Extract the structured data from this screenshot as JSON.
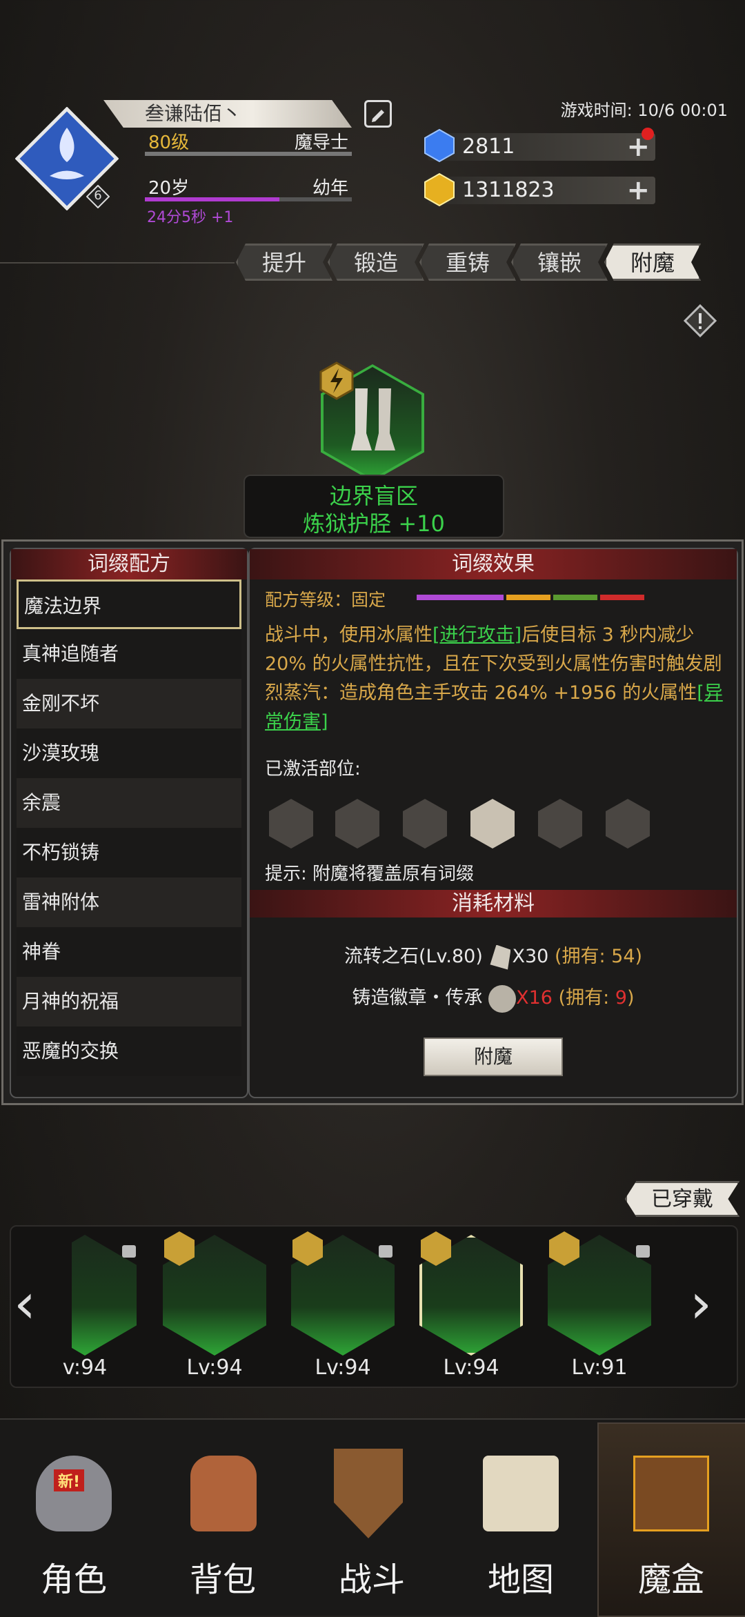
{
  "player": {
    "name": "叁谦陆佰丶",
    "level": "80级",
    "class": "魔导士",
    "age": "20岁",
    "age_stage": "幼年",
    "timer": "24分5秒 +1",
    "rank": "6",
    "age_progress": 0.65
  },
  "game_time": "游戏时间: 10/6 00:01",
  "currency": {
    "gems": "2811",
    "gold": "1311823"
  },
  "tabs": [
    {
      "label": "提升"
    },
    {
      "label": "锻造"
    },
    {
      "label": "重铸"
    },
    {
      "label": "镶嵌"
    },
    {
      "label": "附魔"
    }
  ],
  "item": {
    "zone": "边界盲区",
    "name": "炼狱护胫 +10"
  },
  "recipes": {
    "title": "词缀配方",
    "items": [
      "魔法边界",
      "真神追随者",
      "金刚不坏",
      "沙漠玫瑰",
      "余震",
      "不朽锁铸",
      "雷神附体",
      "神眷",
      "月神的祝福",
      "恶魔的交换"
    ]
  },
  "effect": {
    "title": "词缀效果",
    "grade_label": "配方等级：固定",
    "seg1": "战斗中，使用冰属性",
    "link1": "[进行攻击]",
    "seg2": "后使目标 3 秒内减少 20% 的火属性抗性，且在下次受到火属性伤害时触发剧烈蒸汽：造成角色主手攻击 264% +1956 的火属性",
    "link2": "[异常伤害]",
    "activated_label": "已激活部位:",
    "hint": "提示: 附魔将覆盖原有词缀"
  },
  "materials": {
    "title": "消耗材料",
    "m1_name": "流转之石(Lv.80)",
    "m1_qty": "X30",
    "m1_own": "(拥有: 54)",
    "m2_name": "铸造徽章・传承",
    "m2_qty": "X16",
    "m2_own_pre": "(拥有: ",
    "m2_own_num": "9",
    "m2_own_post": ")"
  },
  "enchant_button": "附魔",
  "equipped_label": "已穿戴",
  "equipment": [
    {
      "lv": "v:94"
    },
    {
      "lv": "Lv:94"
    },
    {
      "lv": "Lv:94"
    },
    {
      "lv": "Lv:94"
    },
    {
      "lv": "Lv:91"
    }
  ],
  "nav": [
    {
      "label": "角色",
      "badge": "新!"
    },
    {
      "label": "背包"
    },
    {
      "label": "战斗"
    },
    {
      "label": "地图"
    },
    {
      "label": "魔盒"
    }
  ],
  "colors": {
    "accent_green": "#3bd14b",
    "panel_red": "#8a2323",
    "gold_text": "#d9a84a"
  }
}
